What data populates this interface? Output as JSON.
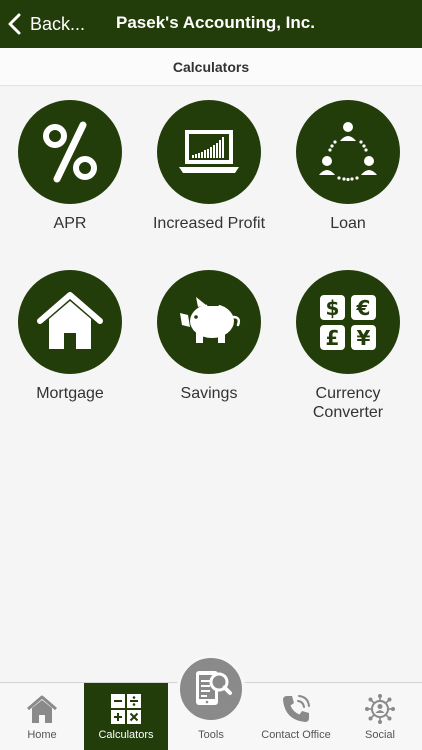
{
  "header": {
    "back_label": "Back...",
    "title": "Pasek's Accounting, Inc."
  },
  "subheader": {
    "title": "Calculators"
  },
  "calculators": [
    {
      "label": "APR",
      "icon": "percent-icon"
    },
    {
      "label": "Increased Profit",
      "icon": "laptop-chart-icon"
    },
    {
      "label": "Loan",
      "icon": "people-network-icon"
    },
    {
      "label": "Mortgage",
      "icon": "house-icon"
    },
    {
      "label": "Savings",
      "icon": "piggy-bank-icon"
    },
    {
      "label": "Currency Converter",
      "icon": "currency-icon"
    }
  ],
  "tabs": [
    {
      "label": "Home",
      "icon": "home-icon",
      "active": false
    },
    {
      "label": "Calculators",
      "icon": "calculator-icon",
      "active": true
    },
    {
      "label": "Tools",
      "icon": "tablet-search-icon",
      "active": false
    },
    {
      "label": "Contact Office",
      "icon": "phone-icon",
      "active": false
    },
    {
      "label": "Social",
      "icon": "social-network-icon",
      "active": false
    }
  ],
  "colors": {
    "brand": "#223d0a",
    "tab_inactive_icon": "#8a8a8a"
  }
}
